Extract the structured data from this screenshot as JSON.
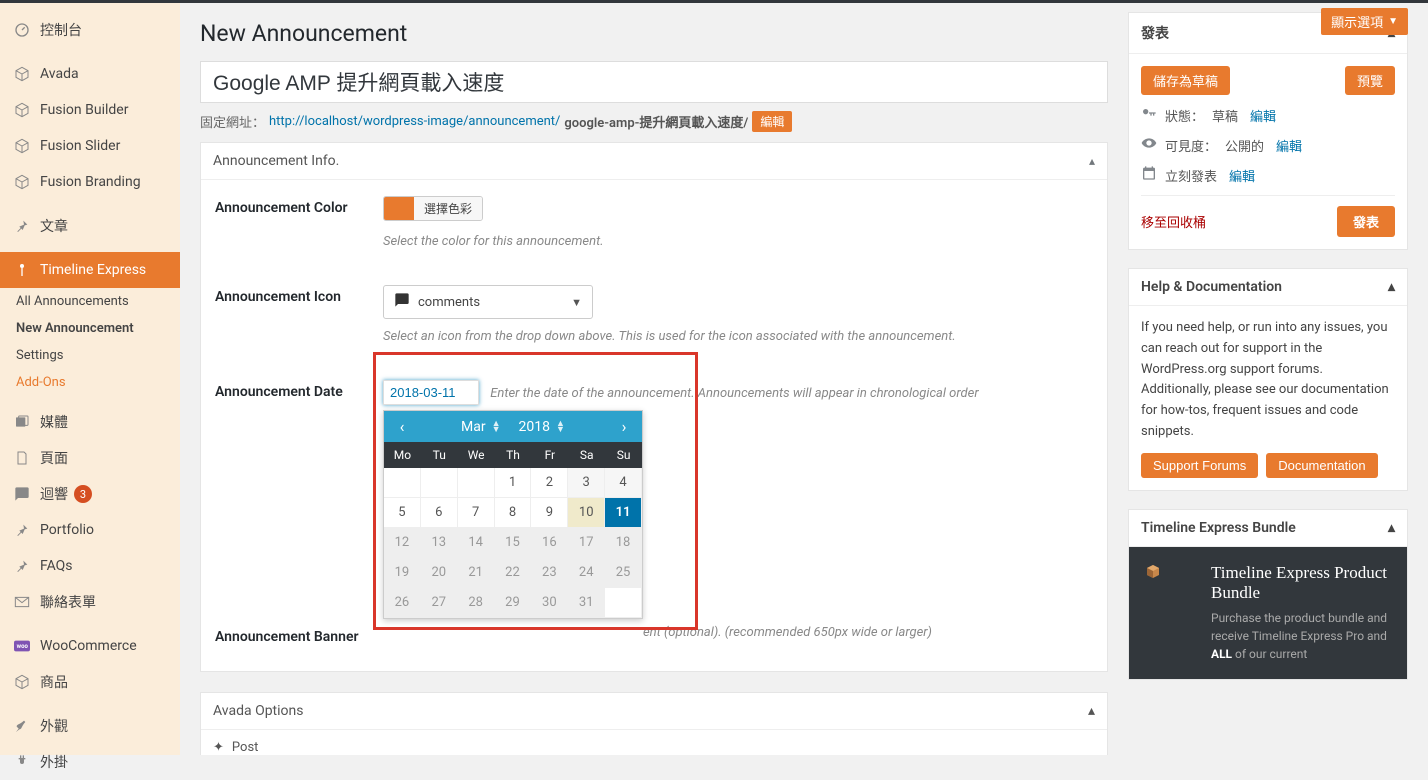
{
  "screen_options": "顯示選項",
  "page_title": "New Announcement",
  "title_value": "Google AMP 提升網頁載入速度",
  "permalink": {
    "label": "固定網址：",
    "base": "http://localhost/wordpress-image/announcement/",
    "slug": "google-amp-提升網頁載入速度/",
    "edit": "編輯"
  },
  "sidebar": {
    "items": [
      {
        "label": "控制台",
        "icon": "dashboard"
      },
      {
        "label": "Avada",
        "icon": "cube"
      },
      {
        "label": "Fusion Builder",
        "icon": "cube"
      },
      {
        "label": "Fusion Slider",
        "icon": "cube"
      },
      {
        "label": "Fusion Branding",
        "icon": "cube"
      },
      {
        "label": "文章",
        "icon": "pin"
      },
      {
        "label": "Timeline Express",
        "icon": "timeline",
        "active": true
      },
      {
        "label": "媒體",
        "icon": "media"
      },
      {
        "label": "頁面",
        "icon": "page"
      },
      {
        "label": "迴響",
        "icon": "comment",
        "count": "3"
      },
      {
        "label": "Portfolio",
        "icon": "pin"
      },
      {
        "label": "FAQs",
        "icon": "pin"
      },
      {
        "label": "聯絡表單",
        "icon": "mail"
      },
      {
        "label": "WooCommerce",
        "icon": "woo"
      },
      {
        "label": "商品",
        "icon": "cube"
      },
      {
        "label": "外觀",
        "icon": "brush"
      },
      {
        "label": "外掛",
        "icon": "plug"
      }
    ],
    "subs": [
      "All Announcements",
      "New Announcement",
      "Settings",
      "Add-Ons"
    ]
  },
  "metabox": {
    "title": "Announcement Info.",
    "fields": {
      "color": {
        "label": "Announcement Color",
        "button": "選擇色彩",
        "hint": "Select the color for this announcement."
      },
      "icon": {
        "label": "Announcement Icon",
        "value": "comments",
        "hint": "Select an icon from the drop down above. This is used for the icon associated with the announcement."
      },
      "date": {
        "label": "Announcement Date",
        "value": "2018-03-11",
        "hint": "Enter the date of the announcement. Announcements will appear in chronological order"
      },
      "banner": {
        "label": "Announcement Banner",
        "hint": "ent (optional). (recommended 650px wide or larger)"
      }
    }
  },
  "calendar": {
    "month": "Mar",
    "year": "2018",
    "dow": [
      "Mo",
      "Tu",
      "We",
      "Th",
      "Fr",
      "Sa",
      "Su"
    ],
    "cells": [
      {
        "d": "",
        "t": "empty"
      },
      {
        "d": "",
        "t": "empty"
      },
      {
        "d": "",
        "t": "empty"
      },
      {
        "d": "1",
        "t": ""
      },
      {
        "d": "2",
        "t": ""
      },
      {
        "d": "3",
        "t": "weekend"
      },
      {
        "d": "4",
        "t": "weekend"
      },
      {
        "d": "5",
        "t": ""
      },
      {
        "d": "6",
        "t": ""
      },
      {
        "d": "7",
        "t": ""
      },
      {
        "d": "8",
        "t": ""
      },
      {
        "d": "9",
        "t": ""
      },
      {
        "d": "10",
        "t": "today"
      },
      {
        "d": "11",
        "t": "selected"
      },
      {
        "d": "12",
        "t": "after"
      },
      {
        "d": "13",
        "t": "after"
      },
      {
        "d": "14",
        "t": "after"
      },
      {
        "d": "15",
        "t": "after"
      },
      {
        "d": "16",
        "t": "after"
      },
      {
        "d": "17",
        "t": "after weekend"
      },
      {
        "d": "18",
        "t": "after weekend"
      },
      {
        "d": "19",
        "t": "after"
      },
      {
        "d": "20",
        "t": "after"
      },
      {
        "d": "21",
        "t": "after"
      },
      {
        "d": "22",
        "t": "after"
      },
      {
        "d": "23",
        "t": "after"
      },
      {
        "d": "24",
        "t": "after weekend"
      },
      {
        "d": "25",
        "t": "after weekend"
      },
      {
        "d": "26",
        "t": "after"
      },
      {
        "d": "27",
        "t": "after"
      },
      {
        "d": "28",
        "t": "after"
      },
      {
        "d": "29",
        "t": "after"
      },
      {
        "d": "30",
        "t": "after"
      },
      {
        "d": "31",
        "t": "after weekend"
      },
      {
        "d": "",
        "t": "empty"
      }
    ]
  },
  "avada_options": {
    "title": "Avada Options",
    "tab": "Post"
  },
  "publish": {
    "title": "發表",
    "save_draft": "儲存為草稿",
    "preview": "預覽",
    "status_label": "狀態：",
    "status_value": "草稿",
    "visibility_label": "可見度：",
    "visibility_value": "公開的",
    "schedule_label": "立刻發表",
    "edit": "編輯",
    "trash": "移至回收桶",
    "submit": "發表"
  },
  "help": {
    "title": "Help & Documentation",
    "text": "If you need help, or run into any issues, you can reach out for support in the WordPress.org support forums. Additionally, please see our documentation for how-tos, frequent issues and code snippets.",
    "forums_btn": "Support Forums",
    "docs_btn": "Documentation"
  },
  "bundle": {
    "title": "Timeline Express Bundle",
    "promo_title": "Timeline Express Product Bundle",
    "promo_text_1": "Purchase the product bundle and receive Timeline Express Pro and ",
    "promo_text_bold": "ALL",
    "promo_text_2": " of our current"
  }
}
